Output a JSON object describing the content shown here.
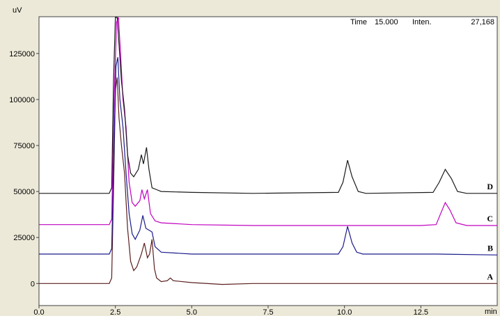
{
  "chart_data": {
    "type": "line",
    "y_unit": "uV",
    "x_unit": "min",
    "xlim": [
      0,
      15
    ],
    "ylim": [
      -12000,
      145000
    ],
    "x_ticks": [
      0,
      2.5,
      5,
      7.5,
      10,
      12.5
    ],
    "x_tick_labels": [
      "0.0",
      "2.5",
      "5.0",
      "7.5",
      "10.0",
      "12.5"
    ],
    "y_ticks": [
      0,
      25000,
      50000,
      75000,
      100000,
      125000
    ],
    "y_tick_labels": [
      "0",
      "25000",
      "50000",
      "75000",
      "100000",
      "125000"
    ],
    "readout": {
      "time_label": "Time",
      "time_value": "15.000",
      "inten_label": "Inten.",
      "inten_value": "27,168"
    },
    "series": [
      {
        "name": "A",
        "color": "#5a1e1e",
        "points": [
          [
            0,
            0
          ],
          [
            2.3,
            0
          ],
          [
            2.38,
            3000
          ],
          [
            2.45,
            60000
          ],
          [
            2.5,
            105000
          ],
          [
            2.56,
            112000
          ],
          [
            2.62,
            90000
          ],
          [
            2.7,
            75000
          ],
          [
            2.8,
            60000
          ],
          [
            2.9,
            30000
          ],
          [
            3.0,
            12000
          ],
          [
            3.1,
            7000
          ],
          [
            3.2,
            9000
          ],
          [
            3.35,
            16000
          ],
          [
            3.45,
            22000
          ],
          [
            3.55,
            14000
          ],
          [
            3.62,
            16000
          ],
          [
            3.7,
            24000
          ],
          [
            3.78,
            8000
          ],
          [
            3.85,
            3000
          ],
          [
            4.0,
            1000
          ],
          [
            4.2,
            1500
          ],
          [
            4.3,
            3000
          ],
          [
            4.4,
            1500
          ],
          [
            5.0,
            500
          ],
          [
            6.0,
            -500
          ],
          [
            7.0,
            0
          ],
          [
            15.0,
            0
          ]
        ]
      },
      {
        "name": "B",
        "color": "#1a1a8c",
        "points": [
          [
            0,
            16000
          ],
          [
            2.3,
            16000
          ],
          [
            2.38,
            19000
          ],
          [
            2.45,
            70000
          ],
          [
            2.52,
            118000
          ],
          [
            2.58,
            123000
          ],
          [
            2.65,
            100000
          ],
          [
            2.75,
            85000
          ],
          [
            2.85,
            60000
          ],
          [
            2.95,
            38000
          ],
          [
            3.05,
            27000
          ],
          [
            3.15,
            24000
          ],
          [
            3.3,
            29000
          ],
          [
            3.4,
            37000
          ],
          [
            3.5,
            30000
          ],
          [
            3.6,
            29000
          ],
          [
            3.7,
            28000
          ],
          [
            3.8,
            20000
          ],
          [
            4.0,
            17000
          ],
          [
            5.0,
            16000
          ],
          [
            9.8,
            16000
          ],
          [
            9.95,
            20000
          ],
          [
            10.1,
            31000
          ],
          [
            10.25,
            22000
          ],
          [
            10.4,
            17000
          ],
          [
            10.6,
            16000
          ],
          [
            13.0,
            16000
          ],
          [
            15.0,
            15500
          ]
        ]
      },
      {
        "name": "C",
        "color": "#c000c0",
        "points": [
          [
            0,
            32000
          ],
          [
            2.3,
            32000
          ],
          [
            2.38,
            35000
          ],
          [
            2.46,
            100000
          ],
          [
            2.54,
            142000
          ],
          [
            2.6,
            145000
          ],
          [
            2.67,
            125000
          ],
          [
            2.75,
            100000
          ],
          [
            2.85,
            85000
          ],
          [
            2.95,
            55000
          ],
          [
            3.05,
            44000
          ],
          [
            3.15,
            42000
          ],
          [
            3.3,
            45000
          ],
          [
            3.37,
            51000
          ],
          [
            3.45,
            46000
          ],
          [
            3.55,
            51000
          ],
          [
            3.65,
            38000
          ],
          [
            3.8,
            34000
          ],
          [
            4.0,
            33000
          ],
          [
            5.0,
            32000
          ],
          [
            7.0,
            31500
          ],
          [
            10.0,
            31500
          ],
          [
            12.5,
            31500
          ],
          [
            13.0,
            32000
          ],
          [
            13.15,
            38000
          ],
          [
            13.3,
            44000
          ],
          [
            13.45,
            40000
          ],
          [
            13.65,
            33000
          ],
          [
            14.0,
            31500
          ],
          [
            15.0,
            31500
          ]
        ]
      },
      {
        "name": "D",
        "color": "#1a1a1a",
        "points": [
          [
            0,
            49000
          ],
          [
            2.3,
            49000
          ],
          [
            2.38,
            52000
          ],
          [
            2.44,
            110000
          ],
          [
            2.5,
            145000
          ],
          [
            2.56,
            145000
          ],
          [
            2.62,
            130000
          ],
          [
            2.7,
            110000
          ],
          [
            2.8,
            95000
          ],
          [
            2.9,
            70000
          ],
          [
            3.0,
            60000
          ],
          [
            3.1,
            58000
          ],
          [
            3.25,
            62000
          ],
          [
            3.35,
            70000
          ],
          [
            3.42,
            65000
          ],
          [
            3.52,
            74000
          ],
          [
            3.6,
            62000
          ],
          [
            3.7,
            52000
          ],
          [
            3.85,
            51000
          ],
          [
            4.0,
            50000
          ],
          [
            5.0,
            49500
          ],
          [
            7.0,
            49000
          ],
          [
            9.8,
            49500
          ],
          [
            9.95,
            55000
          ],
          [
            10.1,
            67000
          ],
          [
            10.25,
            58000
          ],
          [
            10.45,
            50000
          ],
          [
            10.7,
            49000
          ],
          [
            12.9,
            49500
          ],
          [
            13.1,
            55000
          ],
          [
            13.3,
            62000
          ],
          [
            13.5,
            57000
          ],
          [
            13.7,
            50000
          ],
          [
            14.0,
            49000
          ],
          [
            15.0,
            49000
          ]
        ]
      }
    ]
  }
}
